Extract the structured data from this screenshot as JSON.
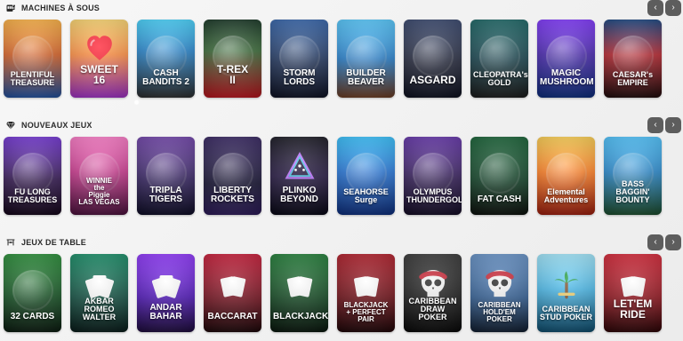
{
  "sections": [
    {
      "title": "MACHINES À SOUS",
      "icon": "slot-machine-icon",
      "nav": {
        "prev": "‹",
        "next": "›"
      },
      "games": [
        {
          "id": "plentiful",
          "label": "PLENTIFUL\nTREASURE"
        },
        {
          "id": "sweet",
          "label": "SWEET\n16"
        },
        {
          "id": "cash",
          "label": "CASH\nBANDITS 2"
        },
        {
          "id": "trex",
          "label": "T-REX\nII"
        },
        {
          "id": "storm",
          "label": "STORM\nLORDS"
        },
        {
          "id": "builder",
          "label": "BUILDER\nBEAVER"
        },
        {
          "id": "asgard",
          "label": "ASGARD"
        },
        {
          "id": "cleo",
          "label": "CLEOPATRA's\nGOLD"
        },
        {
          "id": "magic",
          "label": "MAGIC\nMUSHROOM"
        },
        {
          "id": "caesar",
          "label": "CAESAR's\nEMPIRE"
        }
      ]
    },
    {
      "title": "NOUVEAUX JEUX",
      "icon": "diamond-icon",
      "nav": {
        "prev": "‹",
        "next": "›"
      },
      "games": [
        {
          "id": "fulong",
          "label": "FU LONG\nTREASURES"
        },
        {
          "id": "winnie",
          "label": "WINNIE\nthe\nPiggie\nLAS VEGAS"
        },
        {
          "id": "tripla",
          "label": "TRIPLA\nTIGERS"
        },
        {
          "id": "liberty",
          "label": "LIBERTY\nROCKETS"
        },
        {
          "id": "plinko",
          "label": "PLINKO\nBEYOND"
        },
        {
          "id": "seahorse",
          "label": "SEAHORSE\nSurge"
        },
        {
          "id": "olympus",
          "label": "OLYMPUS\nTHUNDERGOLD"
        },
        {
          "id": "fatcash",
          "label": "FAT CASH"
        },
        {
          "id": "elemental",
          "label": "Elemental\nAdventures"
        },
        {
          "id": "bass",
          "label": "BASS\nBAGGIN'\nBOUNTY"
        }
      ]
    },
    {
      "title": "JEUX DE TABLE",
      "icon": "table-games-icon",
      "nav": {
        "prev": "‹",
        "next": "›"
      },
      "games": [
        {
          "id": "32cards",
          "label": "32 CARDS"
        },
        {
          "id": "akbar",
          "label": "AKBAR\nROMEO\nWALTER"
        },
        {
          "id": "andar",
          "label": "ANDAR\nBAHAR"
        },
        {
          "id": "baccarat",
          "label": "BACCARAT"
        },
        {
          "id": "blackjack",
          "label": "BLACKJACK"
        },
        {
          "id": "blackjack_pp",
          "label": "BLACKJACK\n+ PERFECT PAIR"
        },
        {
          "id": "car_draw",
          "label": "CARIBBEAN\nDRAW POKER"
        },
        {
          "id": "car_holdem",
          "label": "CARIBBEAN\nHOLD'EM\nPOKER"
        },
        {
          "id": "car_stud",
          "label": "CARIBBEAN\nSTUD POKER"
        },
        {
          "id": "letem",
          "label": "LET'EM\nRIDE"
        }
      ]
    }
  ],
  "colors": {
    "nav_bg": "#5d5d5d",
    "header_text": "#2b2b2b",
    "page_bg": "#f2f2f2"
  }
}
